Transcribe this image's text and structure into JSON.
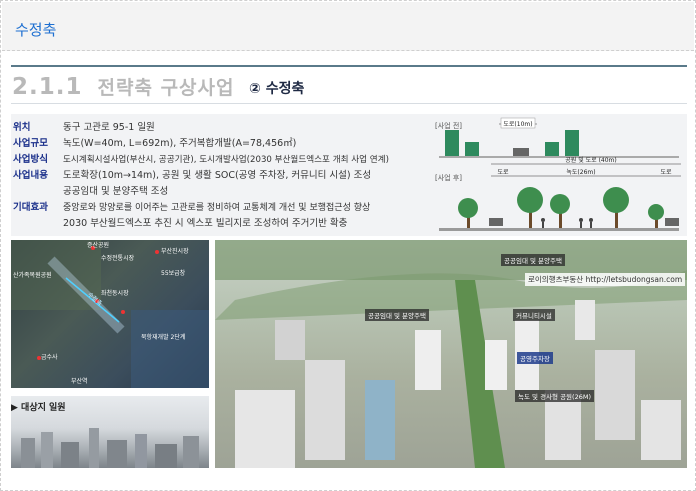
{
  "header": {
    "title": "수정축"
  },
  "section": {
    "number": "2.1.1",
    "title": "전략축 구상사업",
    "sub_title": "② 수정축"
  },
  "info_rows": [
    {
      "label": "위치",
      "value": "동구 고관로 95-1 일원"
    },
    {
      "label": "사업규모",
      "value": "녹도(W=40m, L=692m), 주거복합개발(A=78,456㎡)"
    },
    {
      "label": "사업방식",
      "value": "도시계획시설사업(부산시, 공공기관), 도시개발사업(2030 부산월드엑스포 개최 사업 연계)"
    },
    {
      "label": "사업내용",
      "value": "도로확장(10m→14m), 공원 및 생활 SOC(공영 주차장, 커뮤니티 시설) 조성"
    },
    {
      "label": "",
      "value": "공공임대 및 분양주택 조성"
    },
    {
      "label": "기대효과",
      "value": "중앙로와 망양로를 이어주는 고관로를 정비하여 교통체계 개선 및 보행접근성 향상"
    },
    {
      "label": "",
      "value": "2030 부산월드엑스포 추진 시 엑스포 빌리지로 조성하여 주거기반 확충"
    }
  ],
  "diagram": {
    "before_label": "[사업 전]",
    "after_label": "[사업 후]",
    "road_before": "도로(10m)",
    "park_road": "공원 및 도로 (40m)",
    "road_left": "도로",
    "green_road": "녹도(26m)",
    "road_right": "도로"
  },
  "map": {
    "labels": [
      "증산공원",
      "부산진시장",
      "수정전통시장",
      "55보급창",
      "산가족복원공원",
      "수정축",
      "좌천동시장",
      "북항재개발 2단계",
      "금수사",
      "부산역"
    ]
  },
  "photo_caption": "▶ 대상지 일원",
  "render_tags": {
    "watermark": "로이의행츠부동산 http://letsbudongsan.com",
    "items": [
      "공공임대 및 분양주택",
      "공공임대 및 분양주택",
      "커뮤니티시설",
      "공영주차장",
      "녹도 및 경사형 공원(26M)"
    ]
  },
  "colors": {
    "header_title": "#1d6fd1",
    "label": "#1a2f8a",
    "section_title": "#b9b9b9"
  }
}
